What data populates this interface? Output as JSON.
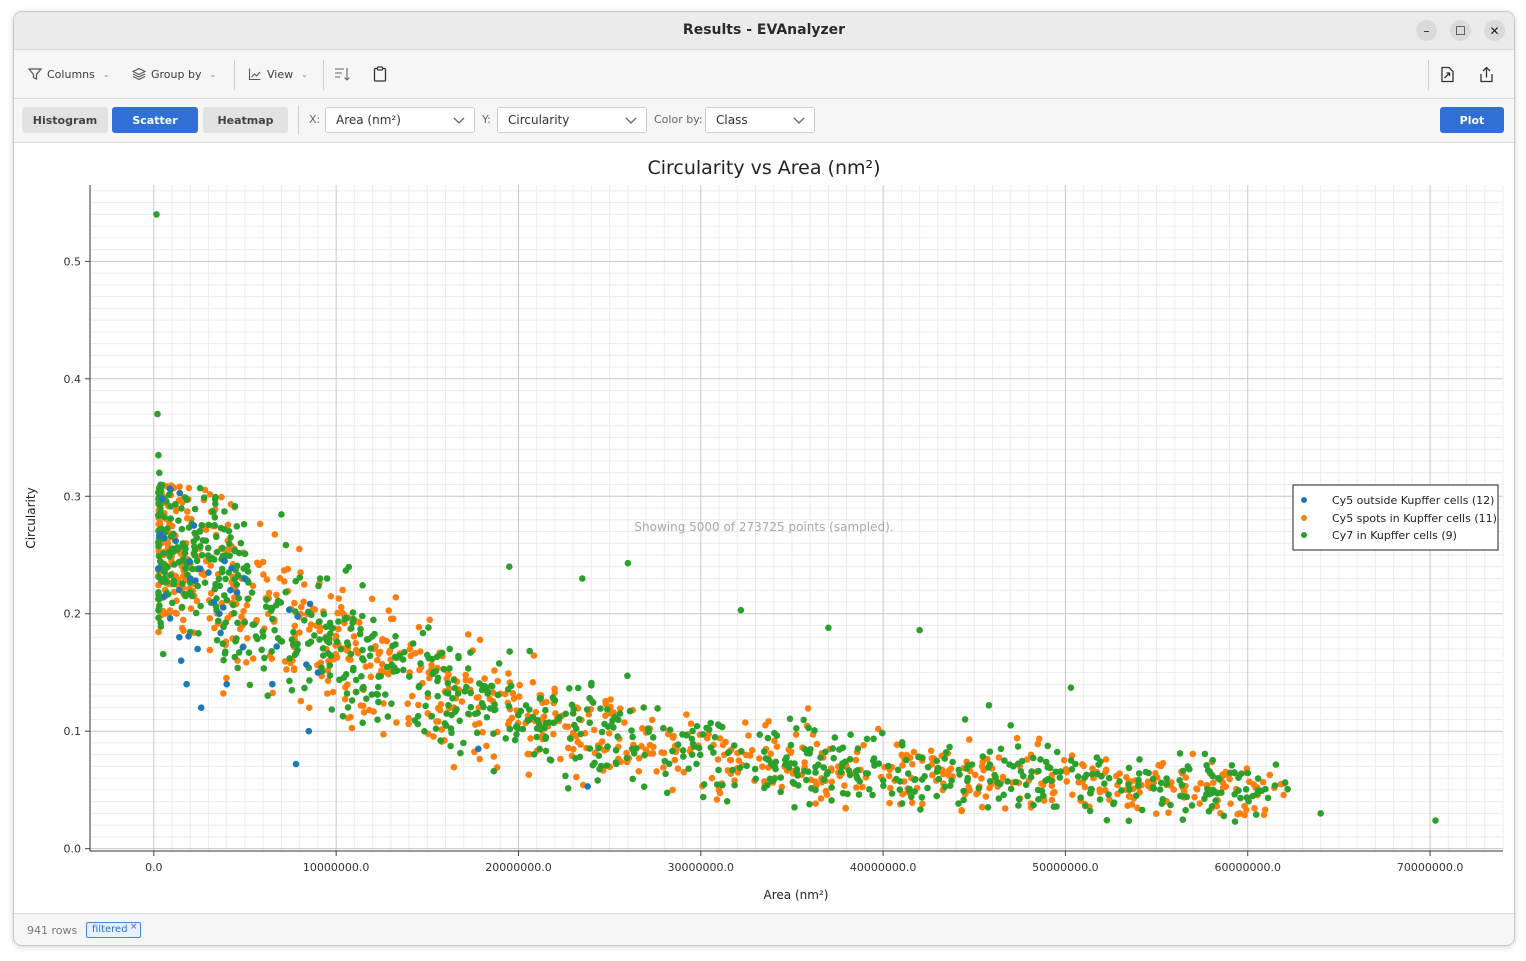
{
  "window": {
    "title": "Results - EVAnalyzer",
    "controls": [
      "–",
      "☐",
      "✕"
    ]
  },
  "toolbar": {
    "columns_label": "Columns",
    "group_by_label": "Group by",
    "view_label": "View"
  },
  "plot_controls": {
    "plot_types": [
      "Histogram",
      "Scatter",
      "Heatmap"
    ],
    "active_type": "Scatter",
    "x_label": "X:",
    "x_value": "Area (nm²)",
    "y_label": "Y:",
    "y_value": "Circularity",
    "color_label": "Color by:",
    "color_value": "Class",
    "plot_button": "Plot"
  },
  "status": {
    "rows": "941 rows",
    "filter_badge": "filtered"
  },
  "colors": {
    "accent": "#2f6fd6",
    "series1": "#1f77b4",
    "series2": "#ff7f0e",
    "series3": "#2ca02c"
  },
  "chart_data": {
    "type": "scatter",
    "title": "Circularity vs Area (nm²)",
    "xlabel": "Area (nm²)",
    "ylabel": "Circularity",
    "annotation": "Showing 5000 of 273725 points (sampled).",
    "xlim": [
      -3500000,
      74000000
    ],
    "ylim": [
      -0.002,
      0.565
    ],
    "xticks": [
      0,
      10000000,
      20000000,
      30000000,
      40000000,
      50000000,
      60000000,
      70000000
    ],
    "xtick_labels": [
      "0.0",
      "10000000.0",
      "20000000.0",
      "30000000.0",
      "40000000.0",
      "50000000.0",
      "60000000.0",
      "70000000.0"
    ],
    "yticks": [
      0.0,
      0.1,
      0.2,
      0.3,
      0.4,
      0.5
    ],
    "ytick_labels": [
      "0.0",
      "0.1",
      "0.2",
      "0.3",
      "0.4",
      "0.5"
    ],
    "grid": true,
    "legend_position": "right",
    "series": [
      {
        "name": "Cy5 outside Kupffer cells (12)",
        "color": "#1f77b4",
        "points": [
          [
            600000,
            0.215
          ],
          [
            900000,
            0.196
          ],
          [
            1200000,
            0.262
          ],
          [
            1400000,
            0.18
          ],
          [
            1500000,
            0.16
          ],
          [
            1800000,
            0.14
          ],
          [
            2000000,
            0.23
          ],
          [
            2200000,
            0.275
          ],
          [
            2400000,
            0.17
          ],
          [
            2600000,
            0.12
          ],
          [
            3000000,
            0.235
          ],
          [
            3300000,
            0.21
          ],
          [
            3600000,
            0.2
          ],
          [
            4000000,
            0.14
          ],
          [
            4200000,
            0.22
          ],
          [
            5000000,
            0.23
          ],
          [
            6500000,
            0.14
          ],
          [
            7800000,
            0.072
          ],
          [
            8500000,
            0.1
          ],
          [
            9000000,
            0.15
          ],
          [
            17800000,
            0.085
          ],
          [
            23800000,
            0.053
          ]
        ]
      },
      {
        "name": "Cy5 spots in Kupffer cells (11)",
        "color": "#ff7f0e",
        "points": []
      },
      {
        "name": "Cy7 in Kupffer cells (9)",
        "color": "#2ca02c",
        "points": [
          [
            150000,
            0.54
          ],
          [
            200000,
            0.37
          ],
          [
            250000,
            0.335
          ],
          [
            300000,
            0.32
          ],
          [
            400000,
            0.305
          ],
          [
            50300000,
            0.137
          ],
          [
            42000000,
            0.186
          ],
          [
            37000000,
            0.188
          ],
          [
            32200000,
            0.203
          ],
          [
            26000000,
            0.243
          ],
          [
            70300000,
            0.024
          ],
          [
            64000000,
            0.03
          ],
          [
            59600000,
            0.043
          ],
          [
            59300000,
            0.023
          ],
          [
            52400000,
            0.06
          ],
          [
            48500000,
            0.05
          ],
          [
            47000000,
            0.105
          ],
          [
            45800000,
            0.122
          ],
          [
            44500000,
            0.11
          ],
          [
            23500000,
            0.23
          ],
          [
            19500000,
            0.24
          ]
        ]
      }
    ]
  }
}
